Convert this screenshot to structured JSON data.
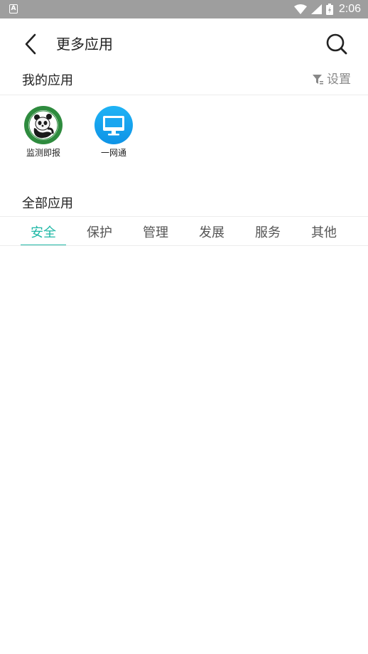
{
  "status_bar": {
    "app_badge": "A",
    "time": "2:06"
  },
  "header": {
    "title": "更多应用"
  },
  "my_apps": {
    "title": "我的应用",
    "settings_label": "设置",
    "items": [
      {
        "label": "监测即报",
        "icon": "panda-logo-icon"
      },
      {
        "label": "一网通",
        "icon": "monitor-icon"
      }
    ]
  },
  "all_apps": {
    "title": "全部应用",
    "tabs": [
      {
        "label": "安全",
        "active": true
      },
      {
        "label": "保护",
        "active": false
      },
      {
        "label": "管理",
        "active": false
      },
      {
        "label": "发展",
        "active": false
      },
      {
        "label": "服务",
        "active": false
      },
      {
        "label": "其他",
        "active": false
      }
    ]
  },
  "colors": {
    "accent": "#1fb8a6",
    "status_bar": "#9e9e9e",
    "monitor_app": "#1aa6f0",
    "panda_logo": "#2e8b3e"
  }
}
